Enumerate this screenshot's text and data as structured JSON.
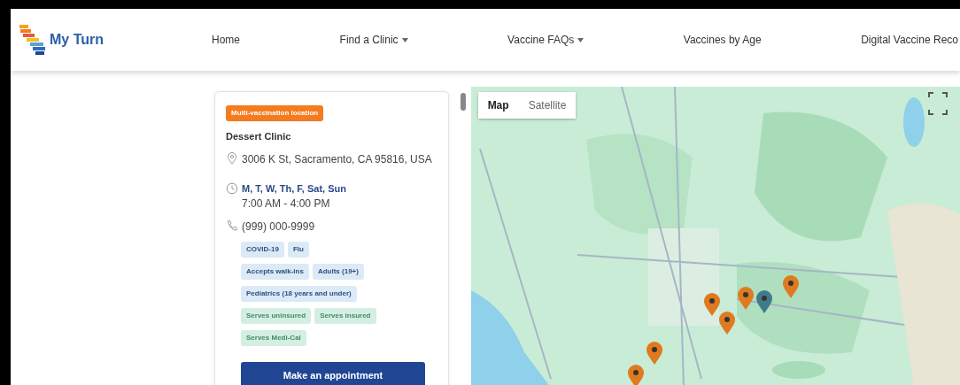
{
  "header": {
    "logo_text": "My Turn",
    "nav": [
      {
        "label": "Home",
        "dropdown": false
      },
      {
        "label": "Find a Clinic",
        "dropdown": true
      },
      {
        "label": "Vaccine FAQs",
        "dropdown": true
      },
      {
        "label": "Vaccines by Age",
        "dropdown": false
      },
      {
        "label": "Digital Vaccine Reco",
        "dropdown": false
      }
    ]
  },
  "clinic": {
    "badge": "Multi-vaccination location",
    "name": "Dessert Clinic",
    "address": "3006 K St, Sacramento, CA 95816, USA",
    "days": "M, T, W, Th, F, Sat, Sun",
    "hours": "7:00 AM - 4:00 PM",
    "phone": "(999) 000-9999",
    "tag_rows": [
      [
        {
          "label": "COVID-19",
          "kind": "service"
        },
        {
          "label": "Flu",
          "kind": "service"
        }
      ],
      [
        {
          "label": "Accepts walk-ins",
          "kind": "service"
        },
        {
          "label": "Adults (19+)",
          "kind": "service"
        }
      ],
      [
        {
          "label": "Pediatrics (18 years and under)",
          "kind": "service"
        }
      ],
      [
        {
          "label": "Serves uninsured",
          "kind": "insurance"
        },
        {
          "label": "Serves insured",
          "kind": "insurance"
        }
      ],
      [
        {
          "label": "Serves Medi-Cal",
          "kind": "insurance"
        }
      ]
    ],
    "button": "Make an appointment"
  },
  "map": {
    "map_types": [
      {
        "label": "Map",
        "selected": true
      },
      {
        "label": "Satellite",
        "selected": false
      }
    ],
    "markers": [
      {
        "selected": false
      },
      {
        "selected": false
      },
      {
        "selected": false
      },
      {
        "selected": true
      },
      {
        "selected": false
      },
      {
        "selected": false
      },
      {
        "selected": false
      }
    ]
  }
}
